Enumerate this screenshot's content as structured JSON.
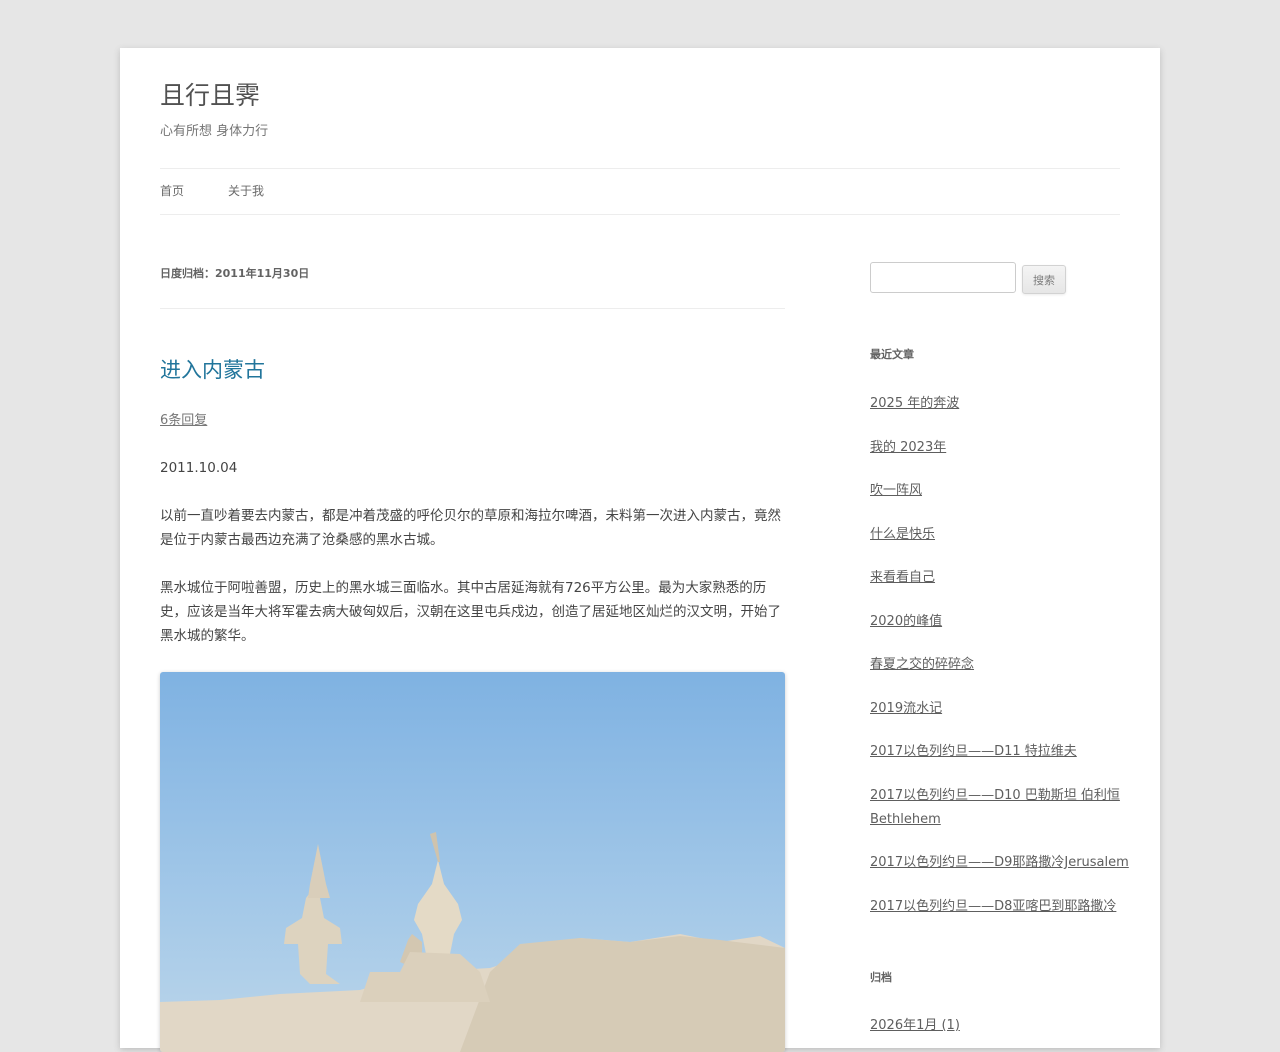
{
  "site": {
    "title": "且行且霁",
    "description": "心有所想 身体力行"
  },
  "nav": {
    "items": [
      "首页",
      "关于我"
    ]
  },
  "archive": {
    "title": "日度归档：2011年11月30日"
  },
  "post": {
    "title": "进入内蒙古",
    "comments": "6条回复",
    "date": "2011.10.04",
    "paragraph1": "以前一直吵着要去内蒙古，都是冲着茂盛的呼伦贝尔的草原和海拉尔啤酒，未料第一次进入内蒙古，竟然是位于内蒙古最西边充满了沧桑感的黑水古城。",
    "paragraph2": "黑水城位于阿啦善盟，历史上的黑水城三面临水。其中古居延海就有726平方公里。最为大家熟悉的历史，应该是当年大将军霍去病大破匈奴后，汉朝在这里屯兵戍边，创造了居延地区灿烂的汉文明，开始了黑水城的繁华。"
  },
  "sidebar": {
    "search_button": "搜索",
    "search_value": "",
    "recent_title": "最近文章",
    "recent": [
      "2025 年的奔波",
      "我的 2023年",
      "吹一阵风",
      "什么是快乐",
      "来看看自己",
      "2020的峰值",
      "春夏之交的碎碎念",
      "2019流水记",
      "2017以色列约旦——D11 特拉维夫",
      "2017以色列约旦——D10 巴勒斯坦 伯利恒 Bethlehem",
      "2017以色列约旦——D9耶路撒冷Jerusalem",
      "2017以色列约旦——D8亚喀巴到耶路撒冷"
    ],
    "archives_title": "归档",
    "archives_first": "2026年1月 (1)"
  },
  "colors": {
    "background": "#e6e6e6",
    "page": "#ffffff",
    "link_title": "#21759b",
    "text": "#444444"
  }
}
